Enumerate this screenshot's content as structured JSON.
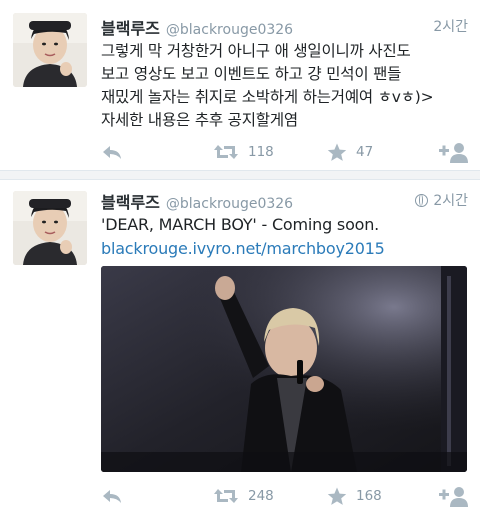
{
  "tweets": [
    {
      "display_name": "블랙루즈",
      "handle": "@blackrouge0326",
      "time": "2시간",
      "text": "그렇게 막 거창한거 아니구 애 생일이니까 사진도\n보고 영상도 보고 이벤트도 하고 걍 민석이 팬들\n재밌게 놀자는 취지로 소박하게 하는거예여 ㅎvㅎ)>\n자세한 내용은 추후 공지할게염",
      "retweets": "118",
      "favorites": "47",
      "avatar_icon": "profile-photo"
    },
    {
      "display_name": "블랙루즈",
      "handle": "@blackrouge0326",
      "time": "2시간",
      "text": "'DEAR, MARCH BOY' - Coming soon.",
      "link": "blackrouge.ivyro.net/marchboy2015",
      "retweets": "248",
      "favorites": "168",
      "avatar_icon": "profile-photo",
      "media_icon": "concert-photo"
    }
  ],
  "colors": {
    "link": "#2b7bb9",
    "meta": "#8899a6",
    "text": "#292f33",
    "divider": "#e1e8ed"
  },
  "icons": {
    "reply": "reply-arrow-icon",
    "retweet": "retweet-icon",
    "favorite": "star-icon",
    "follow": "add-user-icon",
    "globe": "globe-icon"
  }
}
